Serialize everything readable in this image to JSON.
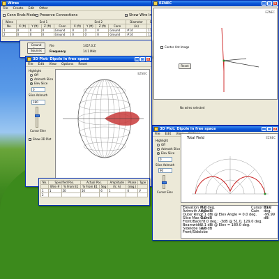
{
  "wires_window": {
    "title": "Wires",
    "menu": [
      "File",
      "Create",
      "Edit",
      "Other"
    ],
    "options": {
      "conn_ends": "Conn Ends Mode",
      "preserve": "Preserve Connections",
      "show_insulation": "Show Wire Insulation"
    },
    "group_headers": [
      "Wires",
      "End 1",
      "End 2",
      "Diameter",
      "Segs",
      "Insulation"
    ],
    "columns": [
      "No.",
      "X (ft)",
      "Y (ft)",
      "Z (ft)",
      "Conn",
      "X (ft)",
      "Y (ft)",
      "Z (ft)",
      "Conn",
      "(in)",
      "",
      "Diel C",
      "Thk (in)"
    ],
    "rows": [
      [
        "1",
        "0",
        "0",
        "0",
        "Ground",
        "0",
        "0",
        "0",
        "Ground",
        "#14",
        "11",
        "1",
        "0"
      ],
      [
        "2",
        "0",
        "0",
        "0",
        "Ground",
        "0",
        "0",
        "0",
        "Ground",
        "#14",
        "11",
        "1",
        "0"
      ]
    ]
  },
  "main_panel": {
    "ground_button": "Ground Spec",
    "sources_button": "Sources",
    "frequency_label": "Frequency",
    "file_label": "File",
    "file_value": "1457.0 Z",
    "freq_value": "14.1 MHz"
  },
  "view_window": {
    "title": "EZNEC",
    "badge": "EZNEC",
    "selected_status": "No wires selected"
  },
  "plot3d_window": {
    "title": "3D Plot: Dipole in free space",
    "menu": [
      "File",
      "Edit",
      "View",
      "Options",
      "Reset"
    ],
    "badge": "EZNEC",
    "highlight": "Highlight",
    "opt_off": "Off",
    "opt_azimuth": "Azimuth Slice",
    "opt_elev": "Elev Slice",
    "slice_azimuth_value": "0",
    "slice_azimuth_label": "Slice Azimuth",
    "cursor_elev_value": "180",
    "cursor_elev_label": "Cursor Elev",
    "show_2d": "Show 2D Plot"
  },
  "polar_window": {
    "title": "3D Plot: Dipole in free space",
    "menu": [
      "File",
      "Edit",
      "View",
      "Options"
    ],
    "badge": "EZNEC",
    "field_title": "Total Field",
    "highlight": "Highlight",
    "opt_off": "Off",
    "opt_azimuth": "Azimuth Slice",
    "opt_elev": "Elev Slice",
    "slice_azimuth_label": "Slice Azimuth",
    "slice_azimuth_value": "0",
    "cursor_elev_label": "Cursor Elev",
    "cursor_elev_value": "90",
    "info_left": [
      "Elevation Plot",
      "Azimuth Angle",
      "Outer Ring",
      "",
      "Slice Max Gain",
      "Front/Back",
      "Beamwidth",
      "Sidelobe Gain",
      "Front/Sidelobe"
    ],
    "info_mid": [
      "",
      "0.0 deg.",
      "0.0 dBi",
      "",
      "2.1 dBi @ Elev Angle = 0.0 deg.",
      "0.0 dB",
      "78.0 deg.; -3dB @ 51.0, 129.0 deg.",
      "2.1 dBi @ Elev = 180.0 deg.",
      "0.0 dB"
    ],
    "info_right": [
      "Cursor Elev",
      "Gain",
      "",
      "",
      "",
      "",
      "",
      "",
      ""
    ],
    "info_right_val": [
      "90.0 deg.",
      "-99.99 dBi",
      "",
      "",
      "",
      "",
      "",
      "",
      ""
    ]
  },
  "sources_window": {
    "columns": [
      "No.",
      "Specified Pos.",
      "",
      "Actual Pos.",
      "",
      "Amplitude",
      "Phase",
      "Type"
    ],
    "subcolumns": [
      "",
      "Wire #",
      "% From E1",
      "% From E1",
      "Seg",
      "(V, A)",
      "(deg.)",
      ""
    ],
    "rows": [
      [
        "1",
        "1",
        "50",
        "50",
        "6",
        "1",
        "0",
        "V"
      ],
      [
        "2",
        "",
        "",
        "",
        "",
        "",
        "",
        ""
      ]
    ]
  }
}
